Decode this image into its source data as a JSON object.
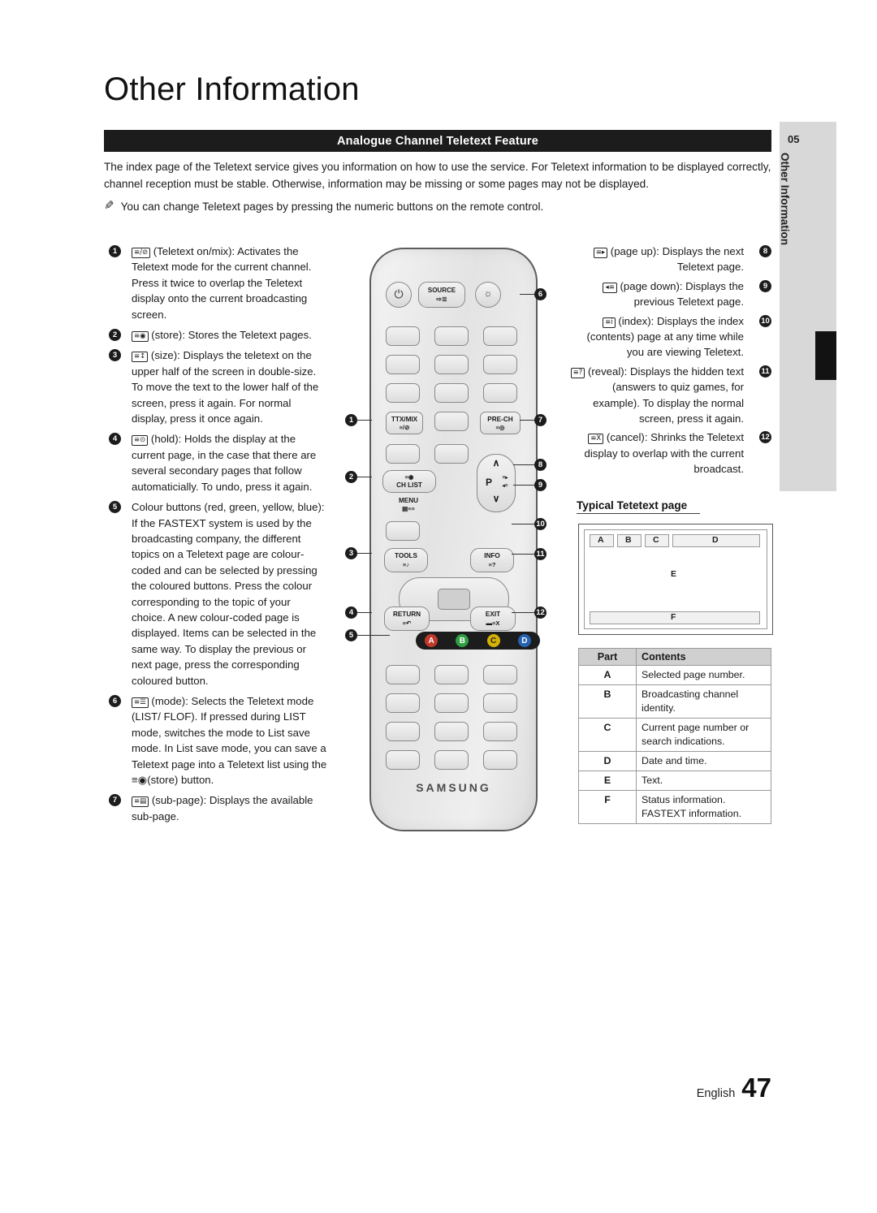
{
  "page_title": "Other Information",
  "section": {
    "heading": "Analogue Channel Teletext Feature"
  },
  "intro": {
    "paragraph": "The index page of the Teletext service gives you information on how to use the service. For Teletext information to be displayed correctly, channel reception must be stable. Otherwise, information may be missing or some pages may not be displayed.",
    "note_icon": "note-pencil-icon",
    "note": "You can change Teletext pages by pressing the numeric buttons on the remote control."
  },
  "side_tab": {
    "number": "05",
    "label": "Other Information"
  },
  "left_items": [
    {
      "num": "1",
      "glyph": "≡/⊘",
      "text": "(Teletext on/mix): Activates the Teletext mode for the current channel. Press it twice to overlap the Teletext display onto the current broadcasting screen."
    },
    {
      "num": "2",
      "glyph": "≡◉",
      "text": "(store): Stores the Teletext pages."
    },
    {
      "num": "3",
      "glyph": "≡↕",
      "text": "(size): Displays the teletext on the upper half of the screen in double-size. To move the text to the lower half of the screen, press it again. For normal display, press it once again."
    },
    {
      "num": "4",
      "glyph": "≡⊙",
      "text": "(hold): Holds the display at the current page, in the case that there are several secondary pages that follow automaticially. To undo, press it again."
    },
    {
      "num": "5",
      "glyph": "",
      "text": "Colour buttons (red, green, yellow, blue): If the FASTEXT system is used by the broadcasting company, the different topics on a Teletext page are colour-coded and can be selected by pressing the coloured buttons. Press the colour corresponding to the topic of your choice. A new colour-coded page is displayed. Items can be selected in the same way. To display the previous or next page, press the corresponding coloured button."
    },
    {
      "num": "6",
      "glyph": "≡☰",
      "text": "(mode): Selects the Teletext mode (LIST/ FLOF). If pressed during LIST mode, switches the mode to List save mode. In List save mode, you can save a Teletext page into a Teletext list using the ≡◉(store) button."
    },
    {
      "num": "7",
      "glyph": "≡▤",
      "text": "(sub-page): Displays the available sub-page."
    }
  ],
  "right_items": [
    {
      "num": "8",
      "glyph": "≡▸",
      "text": "(page up): Displays the next Teletext page."
    },
    {
      "num": "9",
      "glyph": "◂≡",
      "text": "(page down): Displays the previous Teletext page."
    },
    {
      "num": "10",
      "glyph": "≡i",
      "text": "(index): Displays the index (contents) page at any time while you are viewing Teletext."
    },
    {
      "num": "11",
      "glyph": "≡?",
      "text": "(reveal): Displays the hidden text (answers to quiz games, for example). To display the normal screen, press it again."
    },
    {
      "num": "12",
      "glyph": "≡X",
      "text": "(cancel): Shrinks the Teletext display to overlap with the current broadcast."
    }
  ],
  "remote": {
    "power_icon": "power-icon",
    "source_label": "SOURCE",
    "source_icon": "source-icon",
    "brightness_icon": "brightness-icon",
    "ttxmix_label": "TTX/MIX",
    "prech_label": "PRE-CH",
    "chlist_label": "CH LIST",
    "menu_label": "MENU",
    "tools_label": "TOOLS",
    "info_label": "INFO",
    "return_label": "RETURN",
    "exit_label": "EXIT",
    "p_label": "P",
    "up_arrow": "∧",
    "down_arrow": "∨",
    "color_buttons": [
      "A",
      "B",
      "C",
      "D"
    ],
    "brand": "SAMSUNG",
    "callout_left": [
      "1",
      "2",
      "3",
      "4",
      "5"
    ],
    "callout_right": [
      "6",
      "7",
      "8",
      "9",
      "10",
      "11",
      "12"
    ]
  },
  "typical_page": {
    "title": "Typical Tetetext page",
    "screen_labels": [
      "A",
      "B",
      "C",
      "D",
      "E",
      "F"
    ],
    "table": {
      "headers": [
        "Part",
        "Contents"
      ],
      "rows": [
        {
          "part": "A",
          "contents": "Selected page number."
        },
        {
          "part": "B",
          "contents": "Broadcasting channel identity."
        },
        {
          "part": "C",
          "contents": "Current page number or search indications."
        },
        {
          "part": "D",
          "contents": "Date and time."
        },
        {
          "part": "E",
          "contents": "Text."
        },
        {
          "part": "F",
          "contents": "Status information. FASTEXT information."
        }
      ]
    }
  },
  "footer": {
    "language": "English",
    "page_number": "47"
  }
}
